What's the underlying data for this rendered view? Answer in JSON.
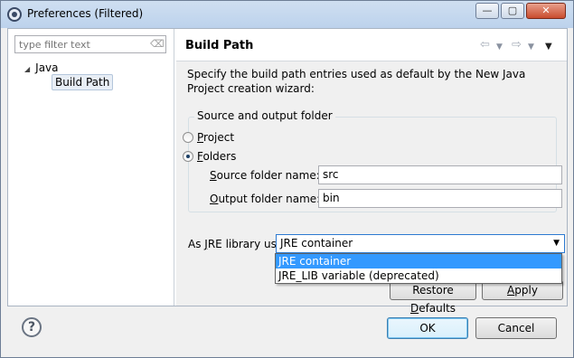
{
  "window": {
    "title": "Preferences (Filtered)",
    "minimize_glyph": "—",
    "maximize_glyph": "▢",
    "close_glyph": "✕"
  },
  "sidebar": {
    "filter_placeholder": "type filter text",
    "tree": [
      {
        "label": "Java",
        "expanded": true
      },
      {
        "label": "Build Path",
        "selected": true
      }
    ]
  },
  "page": {
    "title": "Build Path",
    "description": "Specify the build path entries used as default by the New Java Project creation wizard:",
    "source_output_group": {
      "label": "Source and output folder",
      "options": [
        {
          "label_mnemonic": "P",
          "label_rest": "roject",
          "selected": false
        },
        {
          "label_mnemonic": "F",
          "label_rest": "olders",
          "selected": true
        }
      ],
      "source_folder": {
        "label_mnemonic": "S",
        "label_rest": "ource folder name:",
        "value": "src"
      },
      "output_folder": {
        "label_mnemonic": "O",
        "label_rest": "utput folder name:",
        "value": "bin"
      }
    },
    "jre_library": {
      "label_pre": "As ",
      "label_mnemonic": "J",
      "label_rest": "RE library use:",
      "selected": "JRE container",
      "options": [
        "JRE container",
        "JRE_LIB variable (deprecated)"
      ]
    },
    "buttons": {
      "restore_pre": "Restore ",
      "restore_mnemonic": "D",
      "restore_rest": "efaults",
      "apply_mnemonic": "A",
      "apply_rest": "pply"
    }
  },
  "footer": {
    "help_glyph": "?",
    "ok_label": "OK",
    "cancel_label": "Cancel"
  },
  "icons": [
    "app-icon",
    "clear-filter-icon",
    "tree-expand-icon",
    "back-arrow-icon",
    "forward-arrow-icon",
    "view-menu-icon",
    "help-icon",
    "combo-arrow-icon"
  ]
}
